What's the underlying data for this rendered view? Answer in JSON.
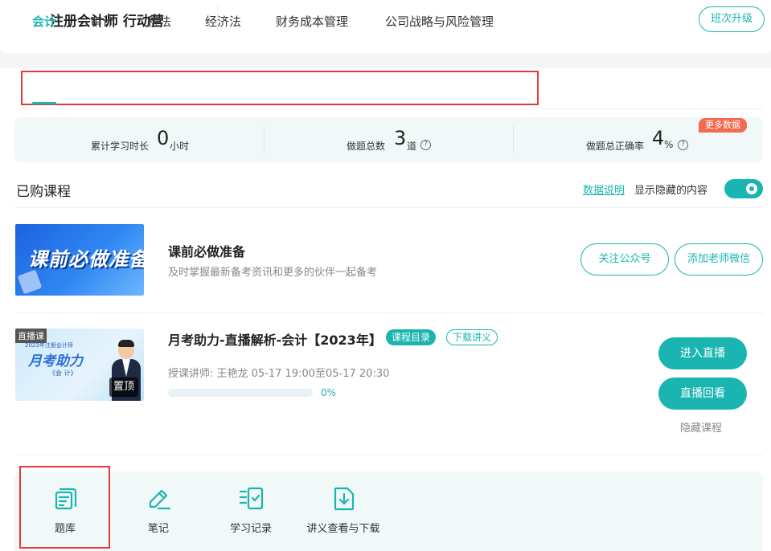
{
  "header": {
    "title": "注册会计师 行动营",
    "upgrade_label": "班次升级"
  },
  "tabs": [
    {
      "label": "会计",
      "active": true
    },
    {
      "label": "审计",
      "active": false
    },
    {
      "label": "税法",
      "active": false
    },
    {
      "label": "经济法",
      "active": false
    },
    {
      "label": "财务成本管理",
      "active": false
    },
    {
      "label": "公司战略与风险管理",
      "active": false
    }
  ],
  "stats": {
    "study_time": {
      "label": "累计学习时长",
      "value": "0",
      "unit": "小时"
    },
    "questions": {
      "label": "做题总数",
      "value": "3",
      "unit": "道"
    },
    "accuracy": {
      "label": "做题总正确率",
      "value": "4",
      "unit": "%"
    },
    "more_badge": "更多数据"
  },
  "purchased": {
    "title": "已购课程",
    "data_link": "数据说明",
    "show_hidden_label": "显示隐藏的内容",
    "show_hidden_on": true
  },
  "courses": [
    {
      "thumb_text": "课前必做准备",
      "title": "课前必做准备",
      "subtitle": "及时掌握最新备考资讯和更多的伙伴一起备考",
      "buttons": [
        "关注公众号",
        "添加老师微信"
      ]
    },
    {
      "live_tag": "直播课",
      "thumb_small": "2023年注册会计师",
      "thumb_big": "月考助力",
      "thumb_sub": "《会 计》",
      "pin_tag": "置顶",
      "title": "月考助力-直播解析-会计【2023年】",
      "tag_catalog": "课程目录",
      "tag_download": "下载讲义",
      "teacher_info": "授课讲师:  王艳龙 05-17 19:00至05-17 20:30",
      "progress": 0,
      "progress_text": "0%",
      "enter_live": "进入直播",
      "replay": "直播回看",
      "hide_course": "隐藏课程"
    }
  ],
  "tools": [
    {
      "label": "题库",
      "icon": "question-bank-icon"
    },
    {
      "label": "笔记",
      "icon": "notes-icon"
    },
    {
      "label": "学习记录",
      "icon": "study-record-icon"
    },
    {
      "label": "讲义查看与下载",
      "icon": "handout-download-icon"
    }
  ],
  "colors": {
    "accent": "#1ab5b0",
    "badge": "#f26a4f",
    "highlight_box": "#e03a3a"
  }
}
